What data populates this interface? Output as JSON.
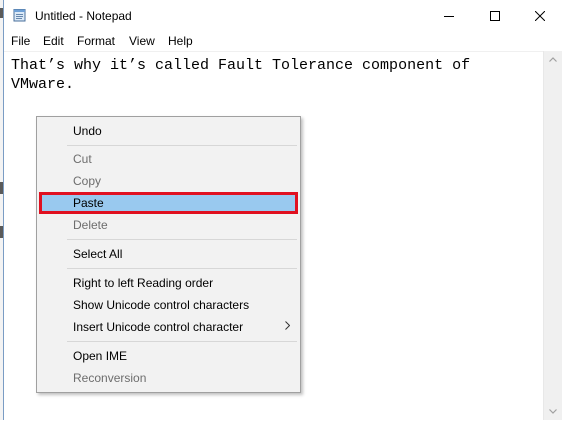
{
  "window": {
    "title": "Untitled - Notepad"
  },
  "menubar": [
    "File",
    "Edit",
    "Format",
    "View",
    "Help"
  ],
  "editor": {
    "text": "That’s why it’s called Fault Tolerance component of VMware."
  },
  "context_menu": {
    "items": [
      {
        "label": "Undo",
        "disabled": false
      },
      {
        "label": "Cut",
        "disabled": true
      },
      {
        "label": "Copy",
        "disabled": true
      },
      {
        "label": "Paste",
        "disabled": false,
        "selected": true
      },
      {
        "label": "Delete",
        "disabled": true
      },
      {
        "label": "Select All",
        "disabled": false
      },
      {
        "label": "Right to left Reading order",
        "disabled": false
      },
      {
        "label": "Show Unicode control characters",
        "disabled": false
      },
      {
        "label": "Insert Unicode control character",
        "disabled": false,
        "has_submenu": true
      },
      {
        "label": "Open IME",
        "disabled": false
      },
      {
        "label": "Reconversion",
        "disabled": true
      }
    ]
  },
  "colors": {
    "highlight": "#99c9ef",
    "annotation_border": "#e01020",
    "menu_bg": "#f2f2f2"
  }
}
